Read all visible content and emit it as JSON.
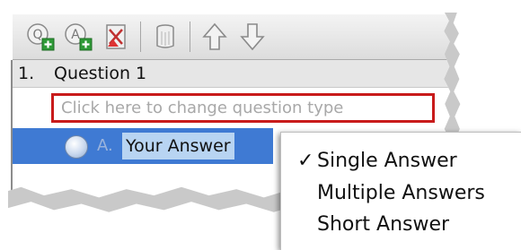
{
  "toolbar": {
    "buttons": [
      {
        "name": "add-question",
        "glyph": "Q"
      },
      {
        "name": "add-answer",
        "glyph": "A"
      },
      {
        "name": "delete",
        "glyph": "x"
      },
      {
        "name": "clear",
        "glyph": "trash"
      },
      {
        "name": "move-up",
        "glyph": "up-arrow"
      },
      {
        "name": "move-down",
        "glyph": "down-arrow"
      }
    ]
  },
  "question": {
    "number": "1.",
    "title": "Question 1",
    "type_prompt": "Click here to change question type"
  },
  "answer": {
    "letter": "A.",
    "text": "Your Answer"
  },
  "menu": {
    "selected": "Single Answer",
    "check_glyph": "✓",
    "items": [
      "Single Answer",
      "Multiple Answers",
      "Short Answer"
    ]
  },
  "colors": {
    "highlight_box": "#c81b1b",
    "selection_row": "#3f7ad3",
    "selection_text_bg": "#b8d4f2"
  }
}
